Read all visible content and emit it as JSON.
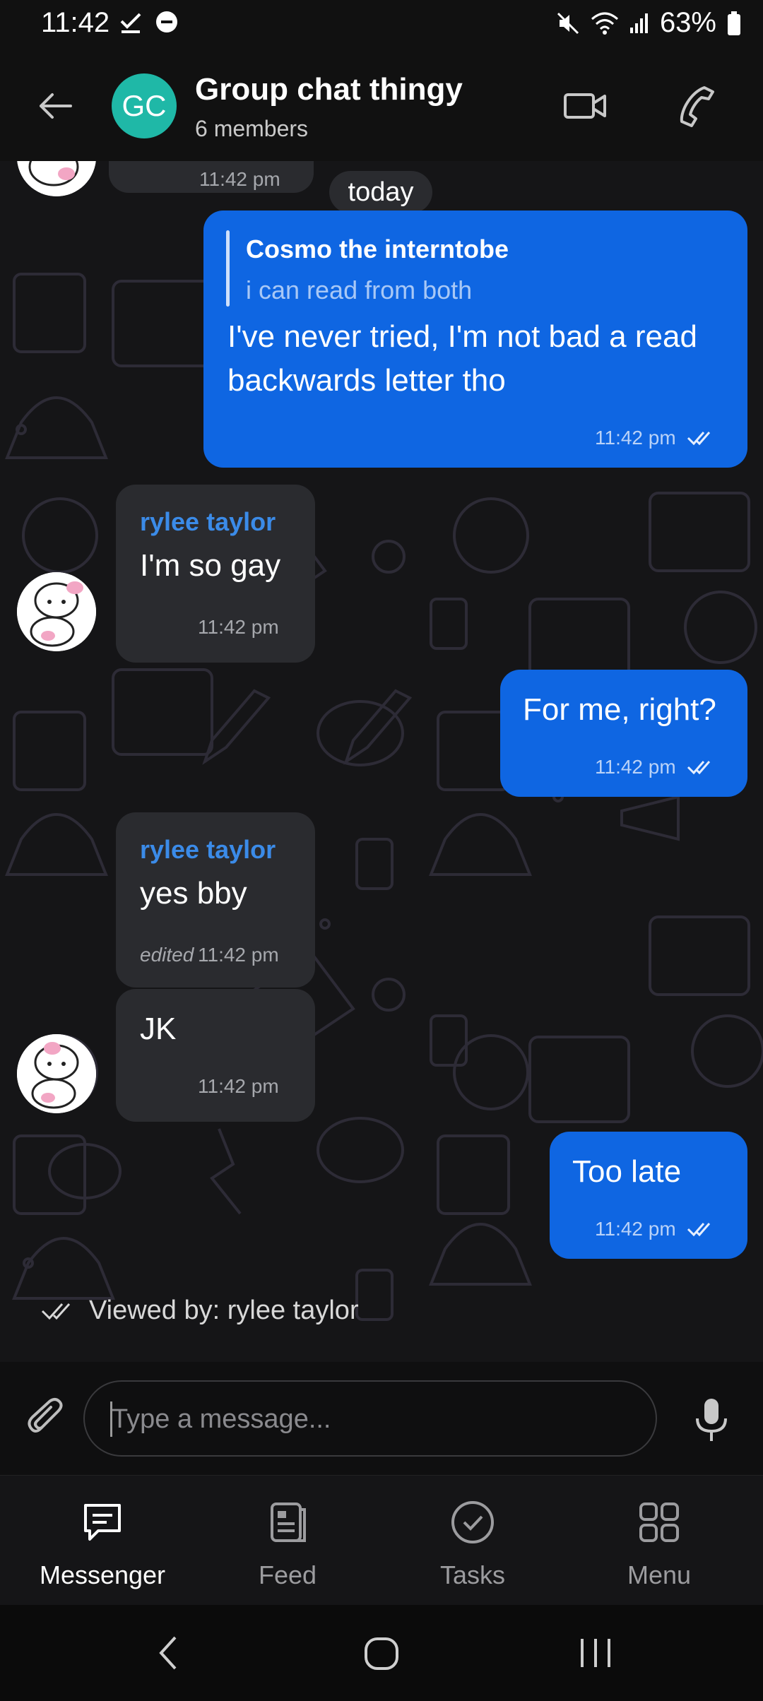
{
  "status_bar": {
    "time": "11:42",
    "battery": "63%",
    "icons": [
      "check-icon",
      "do-not-disturb-icon",
      "mute-icon",
      "wifi-icon",
      "signal-icon",
      "battery-icon"
    ]
  },
  "header": {
    "avatar_initials": "GC",
    "avatar_color": "#1fb8a7",
    "title": "Group chat thingy",
    "subtitle": "6 members"
  },
  "chat": {
    "partial_top_time": "11:42 pm",
    "date_separator": "today",
    "messages": [
      {
        "direction": "outgoing",
        "reply_to": {
          "sender": "Cosmo the interntobe",
          "text": "i can read from both"
        },
        "text_lines": [
          "I've never tried, I'm not bad a read",
          "backwards letter tho"
        ],
        "time": "11:42 pm",
        "status": "read"
      },
      {
        "direction": "incoming",
        "sender": "rylee taylor",
        "text": "I'm so gay",
        "time": "11:42 pm"
      },
      {
        "direction": "outgoing",
        "text": "For me, right?",
        "time": "11:42 pm",
        "status": "read"
      },
      {
        "direction": "incoming",
        "sender": "rylee taylor",
        "text": "yes bby",
        "edited_label": "edited",
        "time": "11:42 pm"
      },
      {
        "direction": "incoming",
        "text": "JK",
        "time": "11:42 pm"
      },
      {
        "direction": "outgoing",
        "text": "Too late",
        "time": "11:42 pm",
        "status": "read"
      }
    ],
    "viewed_by": "Viewed by: rylee taylor"
  },
  "composer": {
    "placeholder": "Type a message..."
  },
  "bottom_nav": {
    "items": [
      {
        "label": "Messenger",
        "active": true
      },
      {
        "label": "Feed",
        "active": false
      },
      {
        "label": "Tasks",
        "active": false
      },
      {
        "label": "Menu",
        "active": false
      }
    ]
  },
  "colors": {
    "outgoing_bubble": "#0f66e2",
    "incoming_bubble": "#2a2b2f",
    "sender_name": "#3b8be8",
    "background": "#151517"
  }
}
